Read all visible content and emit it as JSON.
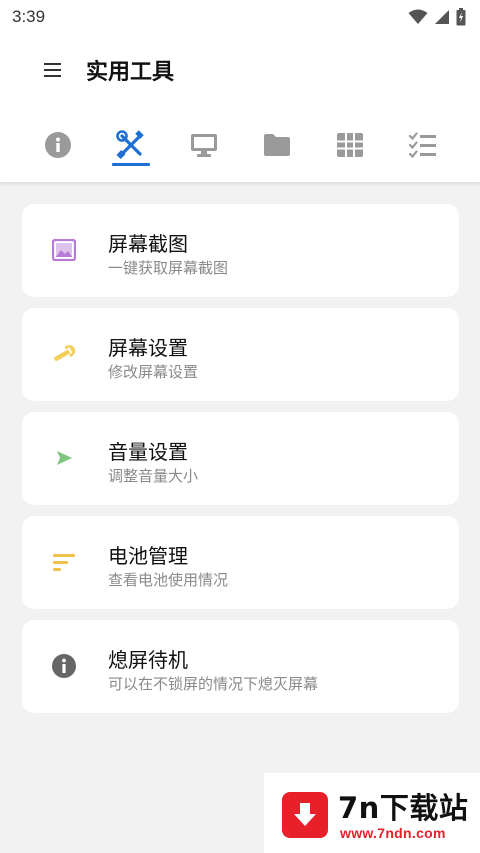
{
  "status_bar": {
    "time": "3:39",
    "icons": [
      "wifi-icon",
      "signal-icon",
      "battery-icon"
    ]
  },
  "app_bar": {
    "title": "实用工具",
    "menu_icon": "menu-icon"
  },
  "tabs": [
    {
      "icon": "info-icon",
      "active": false
    },
    {
      "icon": "tools-icon",
      "active": true
    },
    {
      "icon": "monitor-icon",
      "active": false
    },
    {
      "icon": "folder-icon",
      "active": false
    },
    {
      "icon": "grid-icon",
      "active": false
    },
    {
      "icon": "checklist-icon",
      "active": false
    }
  ],
  "colors": {
    "accent": "#1e6fd1",
    "screenshot_icon": "#b57bd6",
    "wrench_icon": "#f2cf5a",
    "play_icon": "#7fc47f",
    "battery_list_icon": "#f0c14b",
    "info_icon": "#666666"
  },
  "items": [
    {
      "title": "屏幕截图",
      "subtitle": "一键获取屏幕截图",
      "icon": "image-icon"
    },
    {
      "title": "屏幕设置",
      "subtitle": "修改屏幕设置",
      "icon": "wrench-icon"
    },
    {
      "title": "音量设置",
      "subtitle": "调整音量大小",
      "icon": "play-icon"
    },
    {
      "title": "电池管理",
      "subtitle": "查看电池使用情况",
      "icon": "sort-lines-icon"
    },
    {
      "title": "熄屏待机",
      "subtitle": "可以在不锁屏的情况下熄灭屏幕",
      "icon": "info-circle-icon"
    }
  ],
  "watermark": {
    "name": "7n下载站",
    "url": "www.7ndn.com"
  }
}
